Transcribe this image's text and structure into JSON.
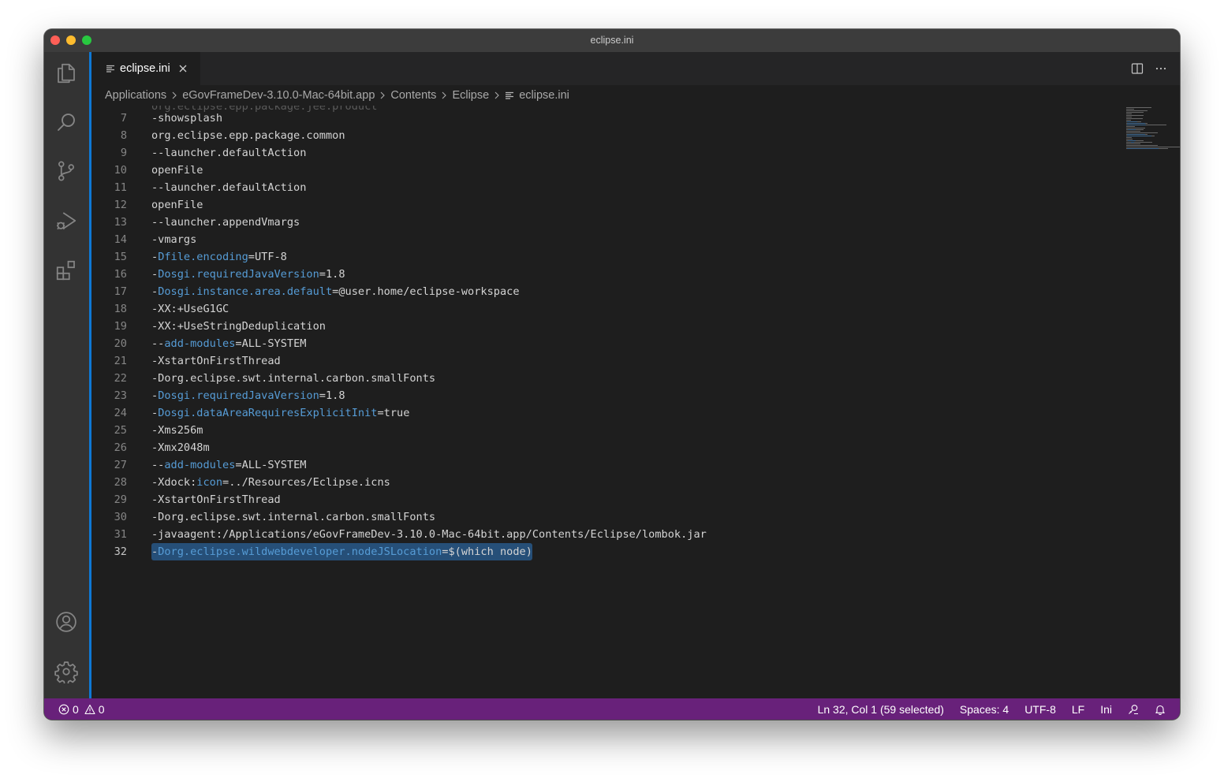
{
  "window": {
    "title": "eclipse.ini"
  },
  "activity_bar": {
    "icons": [
      "files-icon",
      "search-icon",
      "source-control-icon",
      "run-debug-icon",
      "extensions-icon",
      "account-icon",
      "settings-gear-icon"
    ]
  },
  "tab": {
    "label": "eclipse.ini",
    "icon": "file-lines-icon",
    "close_icon": "close-icon"
  },
  "tab_actions": {
    "icons": [
      "split-editor-icon",
      "more-actions-icon"
    ]
  },
  "breadcrumb": {
    "items": [
      "Applications",
      "eGovFrameDev-3.10.0-Mac-64bit.app",
      "Contents",
      "Eclipse"
    ],
    "file": "eclipse.ini"
  },
  "editor": {
    "partial_top_line": "org.eclipse.epp.package.jee.product",
    "lines": [
      {
        "n": "7",
        "segs": [
          {
            "t": "-showsplash",
            "c": ""
          }
        ]
      },
      {
        "n": "8",
        "segs": [
          {
            "t": "org.eclipse.epp.package.common",
            "c": ""
          }
        ]
      },
      {
        "n": "9",
        "segs": [
          {
            "t": "--launcher.defaultAction",
            "c": ""
          }
        ]
      },
      {
        "n": "10",
        "segs": [
          {
            "t": "openFile",
            "c": ""
          }
        ]
      },
      {
        "n": "11",
        "segs": [
          {
            "t": "--launcher.defaultAction",
            "c": ""
          }
        ]
      },
      {
        "n": "12",
        "segs": [
          {
            "t": "openFile",
            "c": ""
          }
        ]
      },
      {
        "n": "13",
        "segs": [
          {
            "t": "--launcher.appendVmargs",
            "c": ""
          }
        ]
      },
      {
        "n": "14",
        "segs": [
          {
            "t": "-vmargs",
            "c": ""
          }
        ]
      },
      {
        "n": "15",
        "segs": [
          {
            "t": "-",
            "c": ""
          },
          {
            "t": "Dfile.encoding",
            "c": "k"
          },
          {
            "t": "=UTF-8",
            "c": ""
          }
        ]
      },
      {
        "n": "16",
        "segs": [
          {
            "t": "-",
            "c": ""
          },
          {
            "t": "Dosgi.requiredJavaVersion",
            "c": "k"
          },
          {
            "t": "=1.8",
            "c": ""
          }
        ]
      },
      {
        "n": "17",
        "segs": [
          {
            "t": "-",
            "c": ""
          },
          {
            "t": "Dosgi.instance.area.default",
            "c": "k"
          },
          {
            "t": "=@user.home/eclipse-workspace",
            "c": ""
          }
        ]
      },
      {
        "n": "18",
        "segs": [
          {
            "t": "-XX:+UseG1GC",
            "c": ""
          }
        ]
      },
      {
        "n": "19",
        "segs": [
          {
            "t": "-XX:+UseStringDeduplication",
            "c": ""
          }
        ]
      },
      {
        "n": "20",
        "segs": [
          {
            "t": "--",
            "c": ""
          },
          {
            "t": "add-modules",
            "c": "k"
          },
          {
            "t": "=ALL-SYSTEM",
            "c": ""
          }
        ]
      },
      {
        "n": "21",
        "segs": [
          {
            "t": "-XstartOnFirstThread",
            "c": ""
          }
        ]
      },
      {
        "n": "22",
        "segs": [
          {
            "t": "-Dorg.eclipse.swt.internal.carbon.smallFonts",
            "c": ""
          }
        ]
      },
      {
        "n": "23",
        "segs": [
          {
            "t": "-",
            "c": ""
          },
          {
            "t": "Dosgi.requiredJavaVersion",
            "c": "k"
          },
          {
            "t": "=1.8",
            "c": ""
          }
        ]
      },
      {
        "n": "24",
        "segs": [
          {
            "t": "-",
            "c": ""
          },
          {
            "t": "Dosgi.dataAreaRequiresExplicitInit",
            "c": "k"
          },
          {
            "t": "=true",
            "c": ""
          }
        ]
      },
      {
        "n": "25",
        "segs": [
          {
            "t": "-Xms256m",
            "c": ""
          }
        ]
      },
      {
        "n": "26",
        "segs": [
          {
            "t": "-Xmx2048m",
            "c": ""
          }
        ]
      },
      {
        "n": "27",
        "segs": [
          {
            "t": "--",
            "c": ""
          },
          {
            "t": "add-modules",
            "c": "k"
          },
          {
            "t": "=ALL-SYSTEM",
            "c": ""
          }
        ]
      },
      {
        "n": "28",
        "segs": [
          {
            "t": "-Xdock:",
            "c": ""
          },
          {
            "t": "icon",
            "c": "k"
          },
          {
            "t": "=../Resources/Eclipse.icns",
            "c": ""
          }
        ]
      },
      {
        "n": "29",
        "segs": [
          {
            "t": "-XstartOnFirstThread",
            "c": ""
          }
        ]
      },
      {
        "n": "30",
        "segs": [
          {
            "t": "-Dorg.eclipse.swt.internal.carbon.smallFonts",
            "c": ""
          }
        ]
      },
      {
        "n": "31",
        "segs": [
          {
            "t": "-javaagent:/Applications/eGovFrameDev-3.10.0-Mac-64bit.app/Contents/Eclipse/lombok.jar",
            "c": ""
          }
        ]
      },
      {
        "n": "32",
        "segs": [
          {
            "t": "-",
            "c": ""
          },
          {
            "t": "Dorg.eclipse.wildwebdeveloper.nodeJSLocation",
            "c": "k"
          },
          {
            "t": "=$(which node)",
            "c": ""
          }
        ],
        "active": true,
        "selected": true
      }
    ]
  },
  "status_bar": {
    "errors": "0",
    "warnings": "0",
    "error_icon": "error-circle-icon",
    "warning_icon": "warning-triangle-icon",
    "position": "Ln 32, Col 1 (59 selected)",
    "spaces": "Spaces: 4",
    "encoding": "UTF-8",
    "eol": "LF",
    "language": "Ini",
    "feedback_icon": "feedback-icon",
    "notifications_icon": "bell-icon"
  },
  "colors": {
    "status_bar": "#68217a",
    "focus_accent": "#0e78d4",
    "keyword": "#569cd6",
    "selection": "#264f78"
  }
}
